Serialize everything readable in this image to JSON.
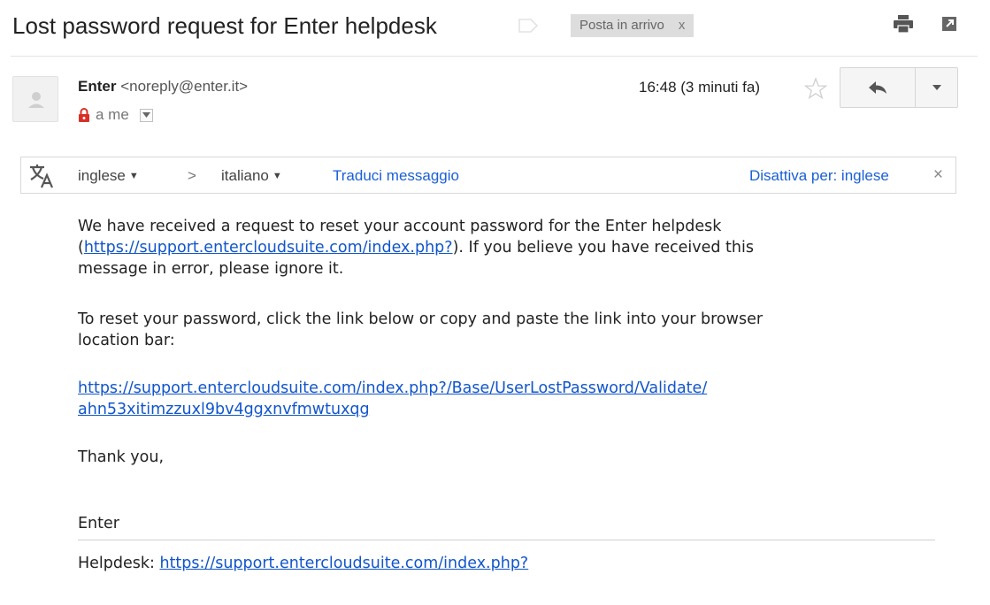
{
  "subject": "Lost password request for Enter helpdesk",
  "inbox_label": {
    "text": "Posta in arrivo",
    "remove": "x"
  },
  "sender": {
    "name": "Enter",
    "email": "<noreply@enter.it>"
  },
  "recipient": "a me",
  "timestamp": "16:48 (3 minuti fa)",
  "translate": {
    "from_lang": "inglese",
    "arrow": ">",
    "to_lang": "italiano",
    "translate_action": "Traduci messaggio",
    "disable_action": "Disattiva per: inglese",
    "close": "×"
  },
  "body": {
    "p1_line1": "We have received a request to reset your account password for the Enter helpdesk",
    "p1_paren_open": "(",
    "p1_link": "https://support.entercloudsuite.com/index.php?",
    "p1_after_link": "). If you believe you have received this",
    "p1_line3": "message in error, please ignore it.",
    "p2_line1": "To reset your password, click the link below or copy and paste the link into your browser",
    "p2_line2": "location bar:",
    "reset_link_line1": "https://support.entercloudsuite.com/index.php?/Base/UserLostPassword/Validate/",
    "reset_link_line2": "ahn53xitimzzuxl9bv4ggxnvfmwtuxqg",
    "thanks": "Thank you,",
    "signature": "Enter",
    "helpdesk_label": "Helpdesk: ",
    "helpdesk_link": "https://support.entercloudsuite.com/index.php?"
  },
  "colors": {
    "link": "#1155cc",
    "lock": "#d93025",
    "chip_bg": "#dddddd"
  },
  "icons": [
    "label-tag-icon",
    "print-icon",
    "popout-icon",
    "avatar-person-icon",
    "lock-icon",
    "chevron-down-icon",
    "star-icon",
    "reply-icon",
    "caret-down-icon",
    "translate-icon",
    "close-icon"
  ]
}
